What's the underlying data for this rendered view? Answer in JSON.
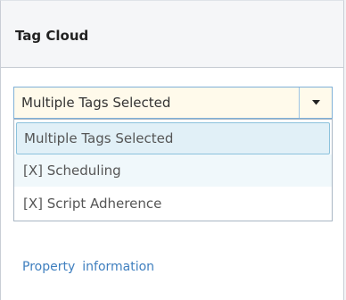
{
  "panel": {
    "title": "Tag Cloud"
  },
  "tag_select": {
    "value": "Multiple Tags Selected",
    "options": [
      "Multiple Tags Selected",
      "[X] Scheduling",
      "[X] Script Adherence"
    ]
  },
  "footer_links": {
    "property": "Property",
    "information": "information"
  },
  "icons": {
    "dropdown_arrow": "chevron-down-icon"
  }
}
